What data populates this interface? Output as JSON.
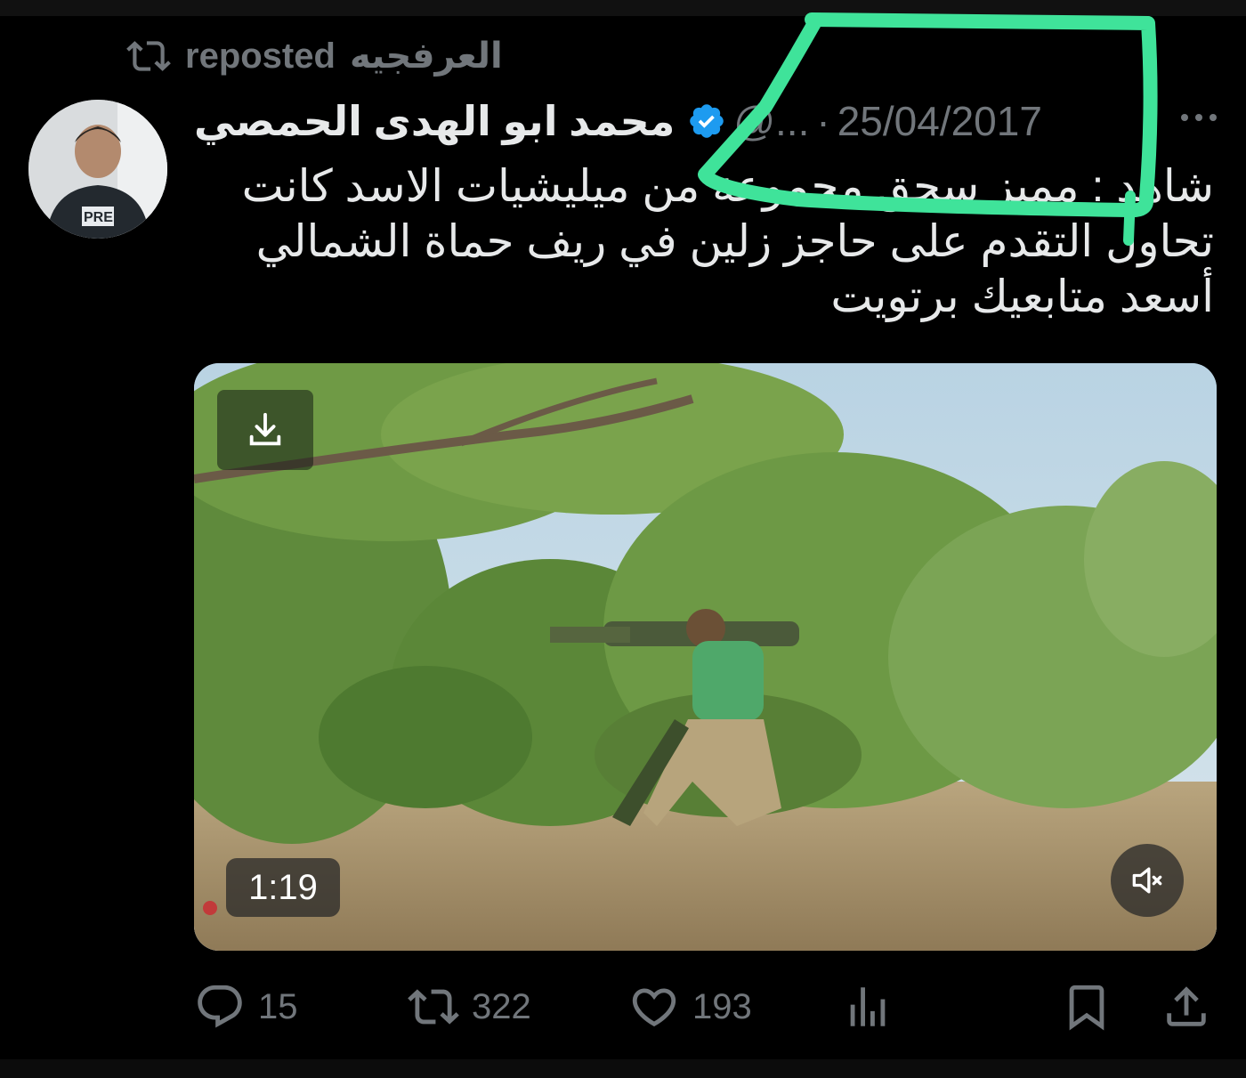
{
  "repost": {
    "reposter_name": "العرفجيه",
    "label": "reposted"
  },
  "tweet": {
    "display_name": "محمد ابو الهدى الحمصي",
    "handle": "@...",
    "separator": "·",
    "date": "25/04/2017",
    "text_lines": [
      "شاهد : مميز سحق مجموعة من ميليشيات الاسد كانت",
      "تحاول التقدم على حاجز زلين في ريف حماة الشمالي",
      "أسعد متابعيك برتويت"
    ]
  },
  "video": {
    "duration": "1:19"
  },
  "actions": {
    "replies": "15",
    "reposts": "322",
    "likes": "193"
  },
  "colors": {
    "background": "#000000",
    "text": "#e7e9ea",
    "muted": "#71767b",
    "verified": "#1d9bf0",
    "annotation": "#3fe39a"
  },
  "icons": {
    "repost": "repost-icon",
    "verified": "verified-badge-icon",
    "more": "more-icon",
    "download": "download-icon",
    "mute": "mute-icon",
    "reply": "reply-icon",
    "like": "heart-icon",
    "views": "views-icon",
    "bookmark": "bookmark-icon",
    "share": "share-icon"
  }
}
